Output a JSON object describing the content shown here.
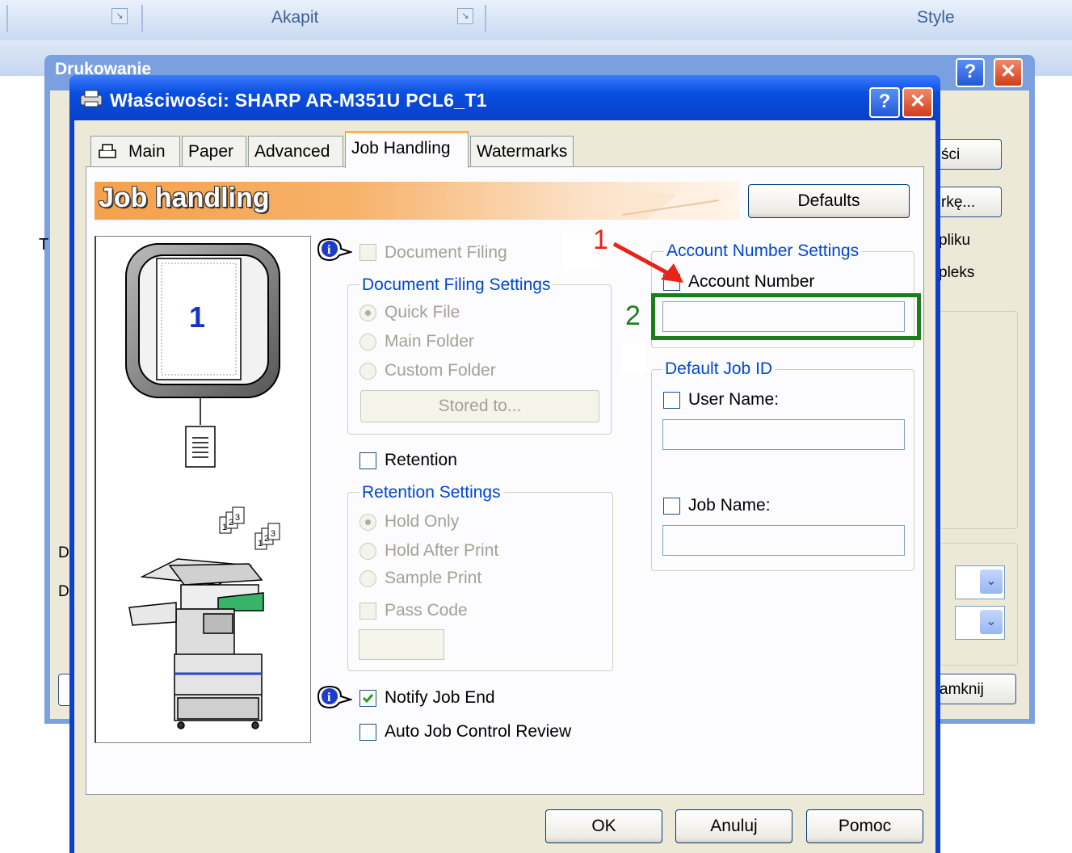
{
  "background_app": {
    "ribbon_groups": [
      "Akapit",
      "Style"
    ],
    "print_dialog_title": "Drukowanie",
    "side_buttons": [
      "ści",
      "rkę..."
    ],
    "side_labels": [
      "pliku",
      "pleks"
    ],
    "left_labels": [
      "T",
      "D",
      "D"
    ],
    "close_button": "amknij"
  },
  "dialog": {
    "title": "Właściwości: SHARP AR-M351U PCL6_T1",
    "help_label": "?",
    "close_label": "✕"
  },
  "tabs": [
    {
      "label": "Main",
      "active": false
    },
    {
      "label": "Paper",
      "active": false
    },
    {
      "label": "Advanced",
      "active": false
    },
    {
      "label": "Job Handling",
      "active": true
    },
    {
      "label": "Watermarks",
      "active": false
    }
  ],
  "header": {
    "title": "Job handling",
    "defaults_button": "Defaults"
  },
  "preview": {
    "page_number": "1"
  },
  "document_filing": {
    "checkbox_label": "Document Filing",
    "settings_label": "Document Filing Settings",
    "options": [
      "Quick File",
      "Main Folder",
      "Custom Folder"
    ],
    "selected": "Quick File",
    "stored_button": "Stored to..."
  },
  "retention": {
    "checkbox_label": "Retention",
    "settings_label": "Retention Settings",
    "options": [
      "Hold Only",
      "Hold After Print",
      "Sample Print"
    ],
    "selected": "Hold Only",
    "pass_code_label": "Pass Code"
  },
  "notify": {
    "notify_label": "Notify Job End",
    "notify_checked": true,
    "auto_review_label": "Auto Job Control Review",
    "auto_review_checked": false
  },
  "account": {
    "group_label": "Account Number Settings",
    "checkbox_label": "Account Number",
    "value": ""
  },
  "job_id": {
    "group_label": "Default Job ID",
    "user_name_label": "User Name:",
    "user_name_value": "",
    "job_name_label": "Job Name:",
    "job_name_value": ""
  },
  "annotations": {
    "marker_1": "1",
    "marker_2": "2",
    "arrow_color": "#e8231a",
    "highlight_color": "#1a7f1a"
  },
  "footer": {
    "ok": "OK",
    "cancel": "Anuluj",
    "help": "Pomoc"
  }
}
